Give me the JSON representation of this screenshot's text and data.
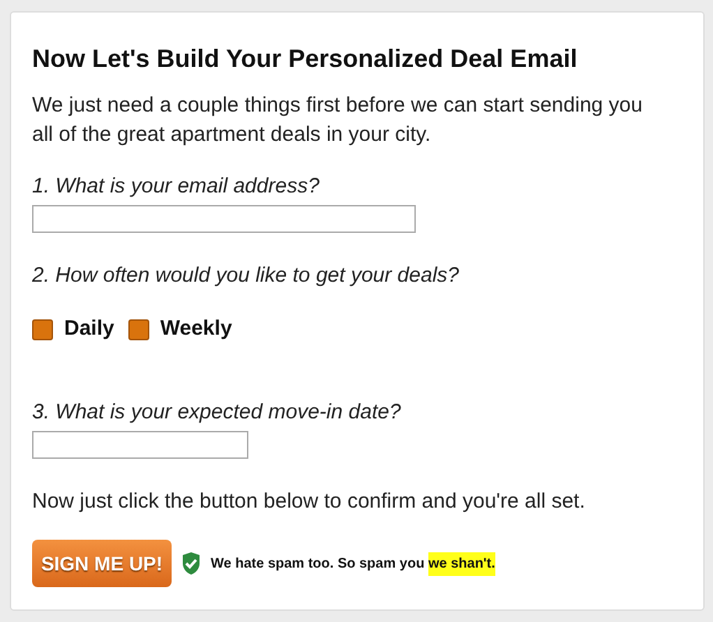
{
  "title": "Now Let's Build Your Personalized Deal Email",
  "intro": "We just need a couple things first before we can start sending you all of the great apartment deals in your city.",
  "questions": [
    {
      "kind": "text",
      "label": "1. What is your email address?"
    },
    {
      "kind": "options",
      "label": "2. How often would you like to get your deals?",
      "options": [
        {
          "label": "Daily",
          "selected": false
        },
        {
          "label": "Weekly",
          "selected": false
        }
      ]
    },
    {
      "kind": "text",
      "label": "3. What is your expected move-in date?"
    }
  ],
  "confirm_text": "Now just click the button below to confirm and you're all set.",
  "submit_button": "SIGN ME UP!",
  "spam_note": {
    "text": "We hate spam too. So spam you ",
    "highlighted": "we shan't."
  }
}
